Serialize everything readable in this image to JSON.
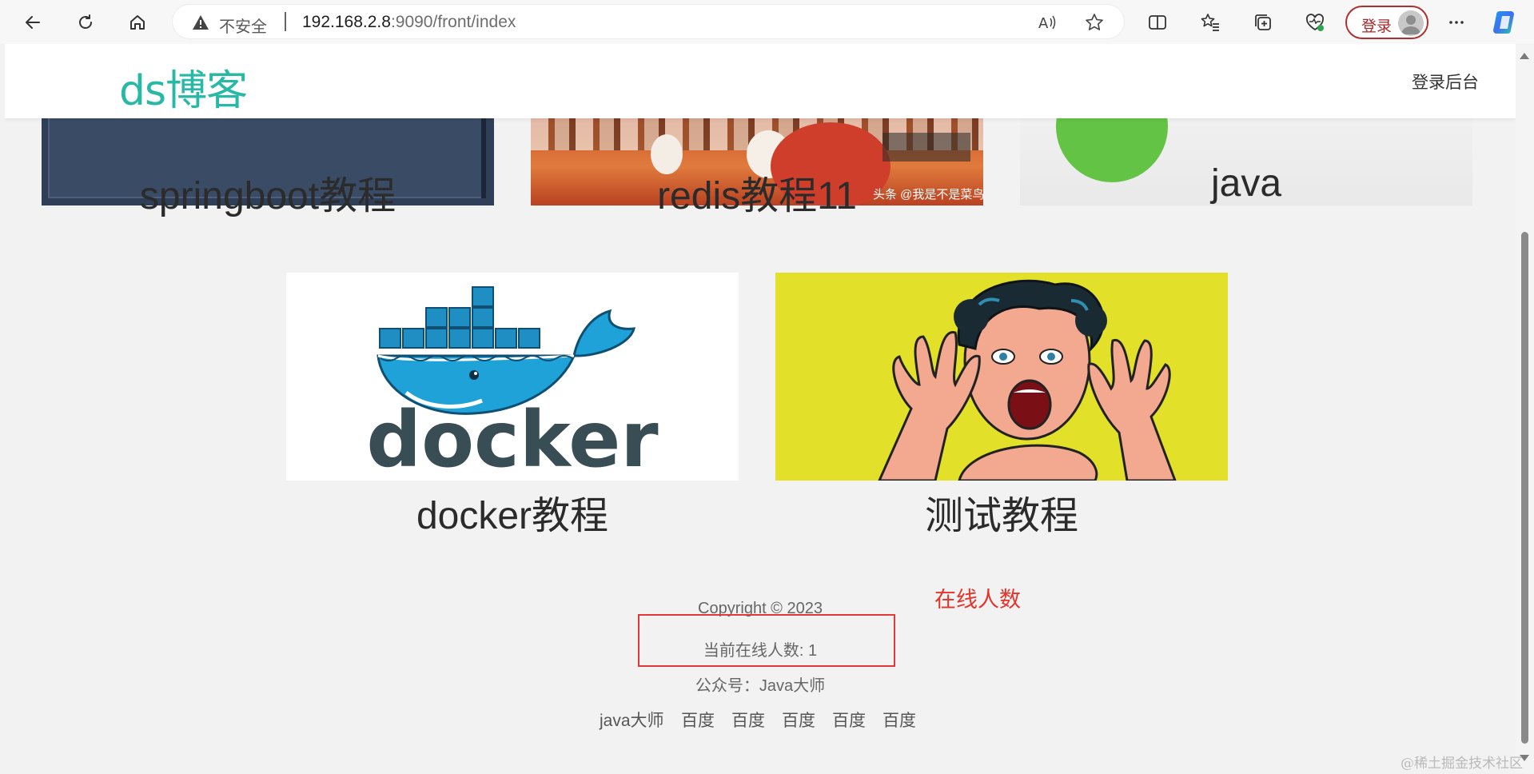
{
  "browser": {
    "insecure_label": "不安全",
    "url_host": "192.168.2.8",
    "url_rest": ":9090/front/index",
    "login_label": "登录"
  },
  "site": {
    "logo": "ds博客",
    "admin_link": "登录后台"
  },
  "cards": [
    {
      "title": "springboot教程"
    },
    {
      "title": "redis教程11",
      "image_caption": "头条 @我是不是菜鸟"
    },
    {
      "title": "java"
    },
    {
      "title": "docker教程",
      "image_text": "docker"
    },
    {
      "title": "测试教程"
    }
  ],
  "footer": {
    "copyright": "Copyright © 2023",
    "online_count": "当前在线人数: 1",
    "wechat": "公众号：Java大师",
    "links": [
      "java大师",
      "百度",
      "百度",
      "百度",
      "百度",
      "百度"
    ]
  },
  "annotation": "在线人数",
  "watermark": "@稀土掘金技术社区",
  "colors": {
    "logo": "#27b8a6",
    "highlight": "#e03a3a",
    "login_border": "#b03030"
  }
}
